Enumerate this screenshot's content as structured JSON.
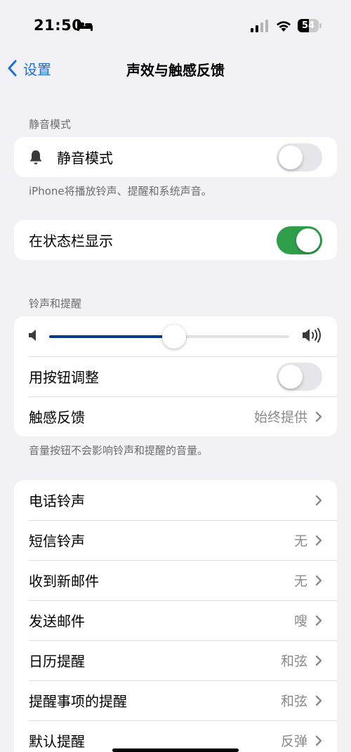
{
  "status_bar": {
    "time": "21:50",
    "battery_level": "54",
    "battery_fraction": 0.54
  },
  "nav": {
    "back_label": "设置",
    "title": "声效与触感反馈"
  },
  "silent_section": {
    "header": "静音模式",
    "silent_label": "静音模式",
    "silent_on": false,
    "footer": "iPhone将播放铃声、提醒和系统声音。"
  },
  "status_bar_section": {
    "show_label": "在状态栏显示",
    "show_on": true
  },
  "ringer_section": {
    "header": "铃声和提醒",
    "volume_level": 0.52,
    "change_with_buttons_label": "用按钮调整",
    "change_with_buttons_on": false,
    "haptics_label": "触感反馈",
    "haptics_value": "始终提供",
    "footer": "音量按钮不会影响铃声和提醒的音量。"
  },
  "sounds_section": {
    "items": [
      {
        "label": "电话铃声",
        "value": ""
      },
      {
        "label": "短信铃声",
        "value": "无"
      },
      {
        "label": "收到新邮件",
        "value": "无"
      },
      {
        "label": "发送邮件",
        "value": "嗖"
      },
      {
        "label": "日历提醒",
        "value": "和弦"
      },
      {
        "label": "提醒事项的提醒",
        "value": "和弦"
      },
      {
        "label": "默认提醒",
        "value": "反弹"
      }
    ]
  }
}
